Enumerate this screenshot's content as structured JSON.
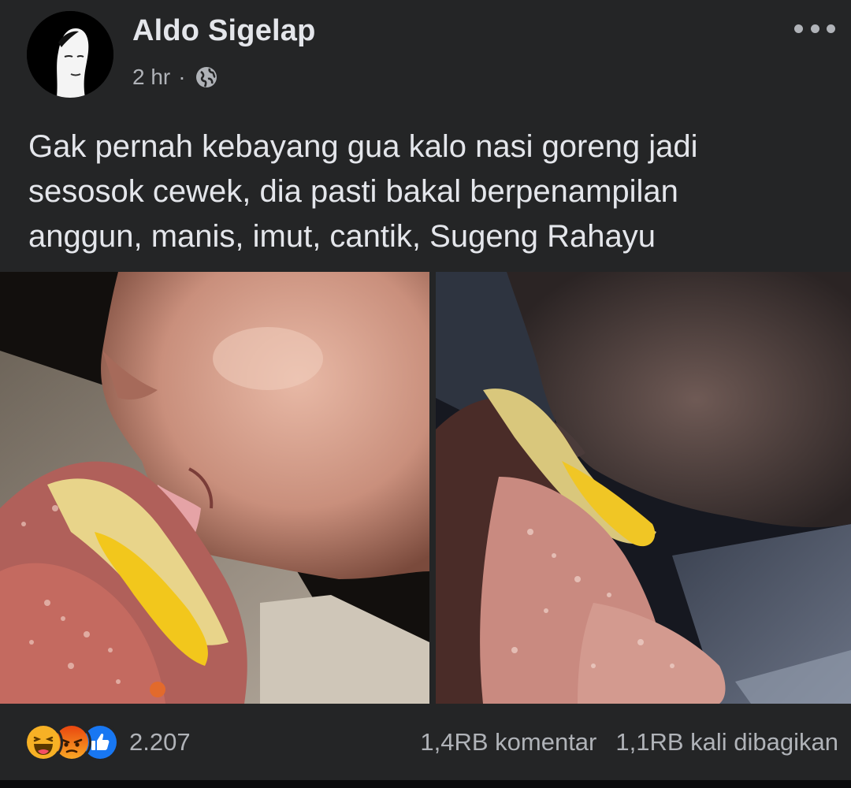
{
  "post": {
    "author": "Aldo Sigelap",
    "time": "2 hr",
    "dot": "·",
    "privacy_icon": "globe-icon",
    "menu_icon": "more-options-icon",
    "text_lines": [
      "Gak pernah kebayang gua kalo nasi goreng jadi",
      "sesosok cewek, dia pasti bakal berpenampilan",
      "anggun, manis, imut, cantik, Sugeng Rahayu"
    ],
    "photos": [
      {
        "alt": "photo-person-licking-fried-rice"
      },
      {
        "alt": "photo-person-eating-fried-rice"
      }
    ]
  },
  "footer": {
    "reaction_icons": [
      "haha-icon",
      "angry-icon",
      "like-icon"
    ],
    "reaction_count": "2.207",
    "comments": "1,4RB komentar",
    "shares": "1,1RB kali dibagikan"
  },
  "colors": {
    "background": "#242526",
    "text_primary": "#e4e6eb",
    "text_secondary": "#b0b3b8",
    "like_blue": "#1877f2",
    "haha_yellow": "#f7b125",
    "angry_orange": "#e9710f"
  }
}
